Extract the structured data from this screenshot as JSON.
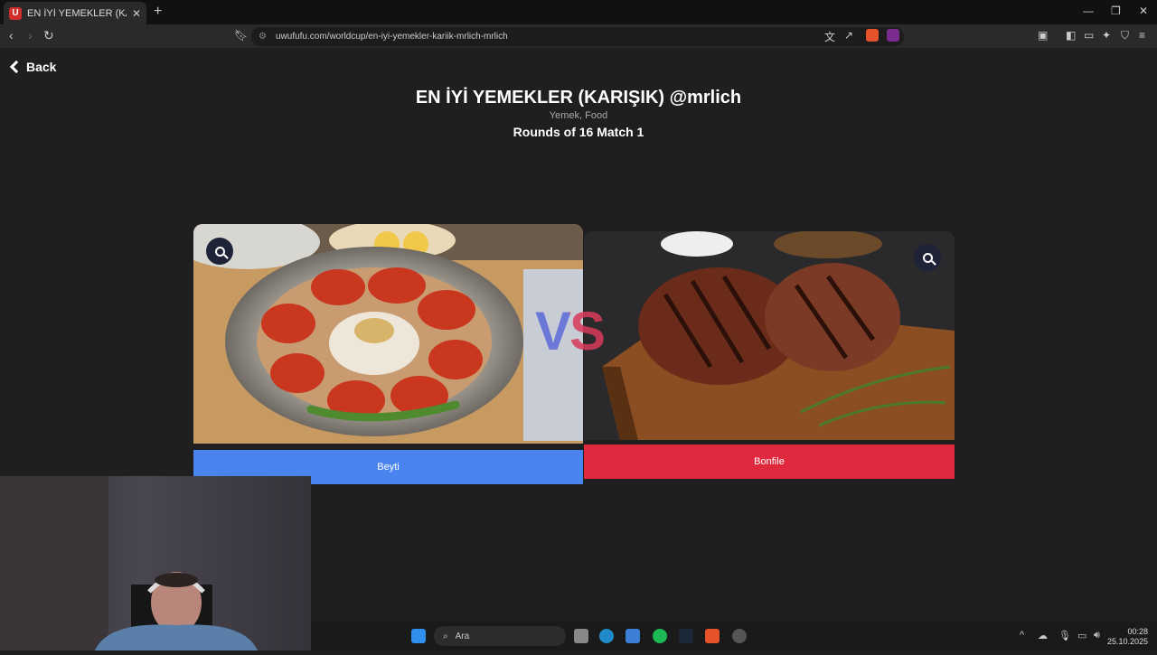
{
  "browser": {
    "tab_title": "EN İYİ YEMEKLER (KARIŞIK) @mrlich",
    "favicon_letter": "U",
    "new_tab": "+",
    "tab_close": "✕",
    "url": "uwufufu.com/worldcup/en-iyi-yemekler-kariik-mrlich-mrlich"
  },
  "page": {
    "back_label": "Back",
    "title": "EN İYİ YEMEKLER (KARIŞIK) @mrlich",
    "subtitle": "Yemek, Food",
    "round": "Rounds of 16 Match 1",
    "vs": "VS"
  },
  "options": [
    {
      "label": "Beyti",
      "color": "#4a84ee",
      "image": "beyti-plate"
    },
    {
      "label": "Bonfile",
      "color": "#e0293e",
      "image": "steak-board"
    }
  ],
  "taskbar": {
    "search_placeholder": "Ara",
    "time": "00:28",
    "date": "25.10.2025"
  },
  "colors": {
    "bg": "#1f1f1f",
    "blue": "#4a84ee",
    "red": "#e0293e"
  }
}
